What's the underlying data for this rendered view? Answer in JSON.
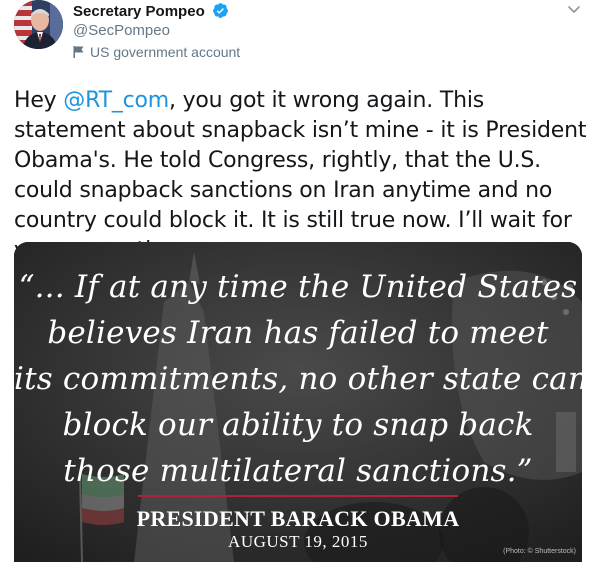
{
  "author": {
    "name": "Secretary Pompeo",
    "handle": "@SecPompeo",
    "label": "US government account",
    "avatar_icon": "profile-photo",
    "verified_icon": "verified-badge-icon",
    "label_icon": "flag-icon"
  },
  "tweet": {
    "text_before": "Hey ",
    "mention": "@RT_com",
    "text_after": ", you got it wrong again. This statement about snapback isn’t mine - it is President Obama's. He told Congress, rightly, that the U.S. could snapback sanctions on Iran anytime and no country could block it. It is still true now. I’ll wait for your correction."
  },
  "media": {
    "quote_lines": [
      "“... If at any time the United States",
      "believes Iran has failed to meet",
      "its commitments, no other state can",
      "block our ability to snap back",
      "those  multilateral sanctions.”"
    ],
    "attribution_name": "PRESIDENT BARACK OBAMA",
    "attribution_date": "AUGUST 19, 2015",
    "photo_credit": "(Photo: © Shutterstock)"
  },
  "colors": {
    "mention": "#1b95e0",
    "verified": "#1da1f2",
    "rule": "#b3203a",
    "secondary_text": "#657786"
  }
}
